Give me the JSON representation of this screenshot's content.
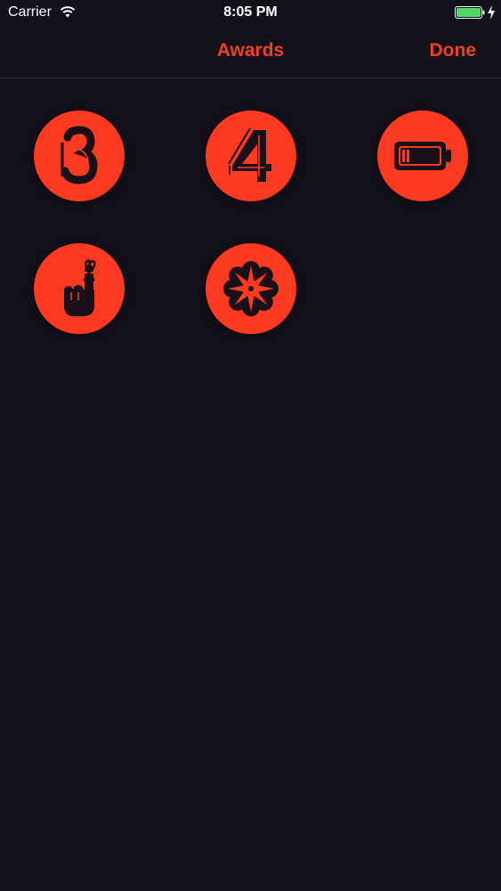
{
  "status_bar": {
    "carrier": "Carrier",
    "time": "8:05 PM"
  },
  "nav": {
    "title": "Awards",
    "done_label": "Done"
  },
  "awards": [
    {
      "icon": "number-three-icon"
    },
    {
      "icon": "number-four-icon"
    },
    {
      "icon": "low-battery-icon"
    },
    {
      "icon": "finger-string-reminder-icon"
    },
    {
      "icon": "flower-mandala-icon"
    }
  ],
  "colors": {
    "accent": "#f13f28",
    "badge": "#fc3a22",
    "background": "#141019"
  }
}
